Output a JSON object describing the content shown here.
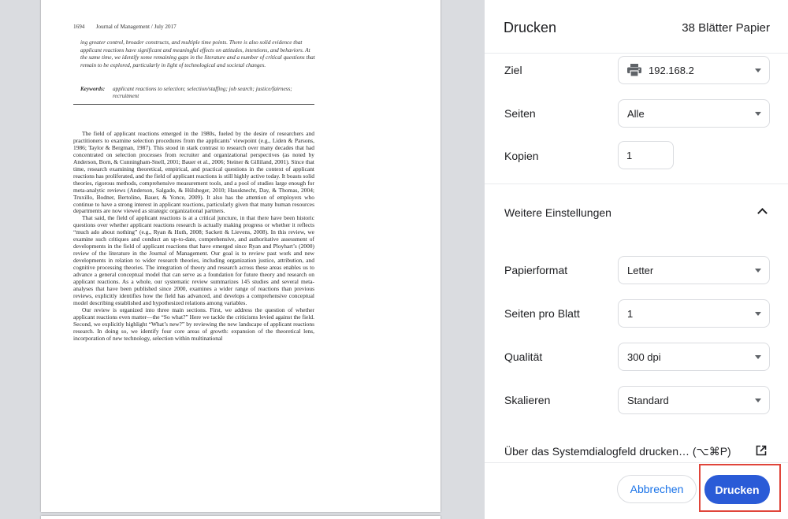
{
  "preview": {
    "running_head": "1694  Journal of Management / July 2017",
    "abstract": "ing greater control, broader constructs, and multiple time points. There is also solid evidence that applicant reactions have significant and meaningful effects on attitudes, intentions, and behaviors. At the same time, we identify some remaining gaps in the literature and a number of critical questions that remain to be explored, particularly in light of technological and societal changes.",
    "keywords_label": "Keywords:",
    "keywords": "applicant reactions to selection; selection/staffing; job search; justice/fairness; recruitment",
    "paragraphs": [
      "The field of applicant reactions emerged in the 1980s, fueled by the desire of researchers and practitioners to examine selection procedures from the applicants’ viewpoint (e.g., Liden & Parsons, 1986; Taylor & Bergman, 1987). This stood in stark contrast to research over many decades that had concentrated on selection processes from recruiter and organizational perspectives (as noted by Anderson, Born, & Cunningham-Snell, 2001; Bauer et al., 2006; Steiner & Gilliland, 2001). Since that time, research examining theoretical, empirical, and practical questions in the context of applicant reactions has proliferated, and the field of applicant reactions is still highly active today. It boasts solid theories, rigorous methods, comprehensive measurement tools, and a pool of studies large enough for meta-analytic reviews (Anderson, Salgado, & Hülsheger, 2010; Hausknecht, Day, & Thomas, 2004; Truxillo, Bodner, Bertolino, Bauer, & Yonce, 2009). It also has the attention of employers who continue to have a strong interest in applicant reactions, particularly given that many human resources departments are now viewed as strategic organizational partners.",
      "That said, the field of applicant reactions is at a critical juncture, in that there have been historic questions over whether applicant reactions research is actually making progress or whether it reflects “much ado about nothing” (e.g., Ryan & Huth, 2008; Sackett & Lievens, 2008). In this review, we examine such critiques and conduct an up-to-date, comprehensive, and authoritative assessment of developments in the field of applicant reactions that have emerged since Ryan and Ployhart’s (2000) review of the literature in the Journal of Management. Our goal is to review past work and new developments in relation to wider research theories, including organization justice, attribution, and cognitive processing theories. The integration of theory and research across these areas enables us to advance a general conceptual model that can serve as a foundation for future theory and research on applicant reactions. As a whole, our systematic review summarizes 145 studies and several meta-analyses that have been published since 2000, examines a wider range of reactions than previous reviews, explicitly identifies how the field has advanced, and develops a comprehensive conceptual model describing established and hypothesized relations among variables.",
      "Our review is organized into three main sections. First, we address the question of whether applicant reactions even matter—the “So what?” Here we tackle the criticisms levied against the field. Second, we explicitly highlight “What’s new?” by reviewing the new landscape of applicant reactions research. In doing so, we identify four core areas of growth: expansion of the theoretical lens, incorporation of new technology, selection within multinational"
    ]
  },
  "dialog": {
    "title": "Drucken",
    "sheets": "38 Blätter Papier",
    "destination": {
      "label": "Ziel",
      "value": "192.168.2",
      "icon": "printer-icon"
    },
    "pages": {
      "label": "Seiten",
      "value": "Alle"
    },
    "copies": {
      "label": "Kopien",
      "value": "1"
    },
    "more_settings": {
      "label": "Weitere Einstellungen",
      "icon": "chevron-up-icon"
    },
    "paper_size": {
      "label": "Papierformat",
      "value": "Letter"
    },
    "pages_per_sheet": {
      "label": "Seiten pro Blatt",
      "value": "1"
    },
    "quality": {
      "label": "Qualität",
      "value": "300 dpi"
    },
    "scale": {
      "label": "Skalieren",
      "value": "Standard"
    },
    "system_dialog": {
      "label": "Über das Systemdialogfeld drucken… (⌥⌘P)",
      "icon": "open-external-icon"
    },
    "cancel_label": "Abbrechen",
    "print_label": "Drucken"
  },
  "colors": {
    "accent": "#1a73e8",
    "print_button": "#2a5bd7",
    "highlight": "#e0453a",
    "preview_bg": "#dadce0"
  }
}
